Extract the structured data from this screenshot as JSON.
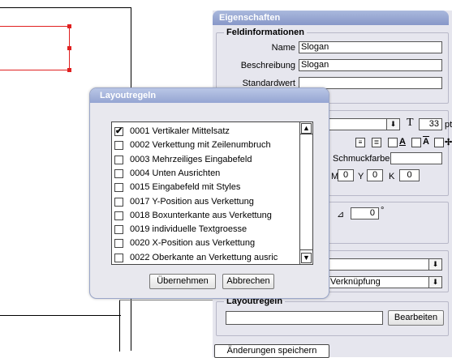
{
  "canvas": {
    "accent": "#e02020"
  },
  "properties": {
    "title": "Eigenschaften",
    "field_info": {
      "legend": "Feldinformationen",
      "name_label": "Name",
      "name_value": "Slogan",
      "description_label": "Beschreibung",
      "description_value": "Slogan",
      "default_label": "Standardwert",
      "default_value": ""
    },
    "text": {
      "font_size_value": "33",
      "font_size_unit": "pt",
      "spot_color_label": "Schmuckfarbe",
      "spot_color_value": "",
      "m_label": "M",
      "m_value": "0",
      "y_label": "Y",
      "y_value": "0",
      "k_label": "K",
      "k_value": "0",
      "rotation_value": "0",
      "rotation_unit": "°"
    },
    "link": {
      "select1_value": "",
      "select2_value": "Verknüpfung"
    },
    "layout_rules": {
      "legend": "Layoutregeln",
      "value": "",
      "edit_button": "Bearbeiten"
    },
    "save_button": "Änderungen speichern"
  },
  "dialog": {
    "title": "Layoutregeln",
    "rules": [
      {
        "label": "0001 Vertikaler Mittelsatz",
        "checked": "✔"
      },
      {
        "label": "0002 Verkettung mit Zeilenumbruch",
        "checked": ""
      },
      {
        "label": "0003 Mehrzeiliges Eingabefeld",
        "checked": ""
      },
      {
        "label": "0004 Unten Ausrichten",
        "checked": ""
      },
      {
        "label": "0015 Eingabefeld mit Styles",
        "checked": ""
      },
      {
        "label": "0017 Y-Position aus Verkettung",
        "checked": ""
      },
      {
        "label": "0018 Boxunterkante aus Verkettung",
        "checked": ""
      },
      {
        "label": "0019 individuelle Textgroesse",
        "checked": ""
      },
      {
        "label": "0020 X-Position aus Verkettung",
        "checked": ""
      },
      {
        "label": "0022 Oberkante an Verkettung ausric",
        "checked": ""
      }
    ],
    "apply_button": "Übernehmen",
    "cancel_button": "Abbrechen"
  }
}
